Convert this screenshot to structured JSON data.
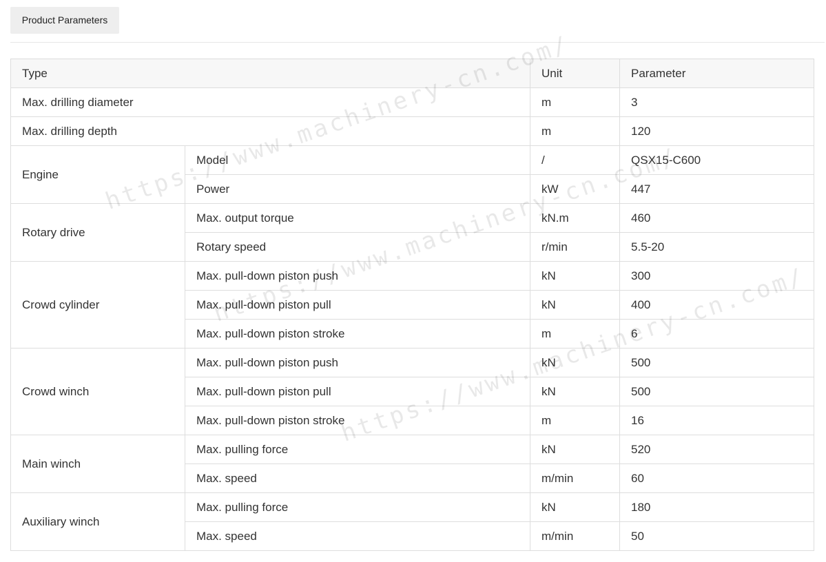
{
  "tab": {
    "label": "Product Parameters"
  },
  "table": {
    "headers": {
      "type": "Type",
      "unit": "Unit",
      "parameter": "Parameter"
    },
    "rows": [
      {
        "group": "Max. drilling diameter",
        "unit": "m",
        "value": "3"
      },
      {
        "group": "Max. drilling depth",
        "unit": "m",
        "value": "120"
      },
      {
        "group": "Engine",
        "items": [
          {
            "name": "Model",
            "unit": "/",
            "value": "QSX15-C600"
          },
          {
            "name": "Power",
            "unit": "kW",
            "value": "447"
          }
        ]
      },
      {
        "group": "Rotary drive",
        "items": [
          {
            "name": "Max. output torque",
            "unit": "kN.m",
            "value": "460"
          },
          {
            "name": "Rotary speed",
            "unit": "r/min",
            "value": "5.5-20"
          }
        ]
      },
      {
        "group": "Crowd cylinder",
        "items": [
          {
            "name": "Max. pull-down piston push",
            "unit": "kN",
            "value": "300"
          },
          {
            "name": "Max. pull-down piston pull",
            "unit": "kN",
            "value": "400"
          },
          {
            "name": "Max. pull-down piston stroke",
            "unit": "m",
            "value": "6"
          }
        ]
      },
      {
        "group": "Crowd winch",
        "items": [
          {
            "name": "Max. pull-down piston push",
            "unit": "kN",
            "value": "500"
          },
          {
            "name": "Max. pull-down piston pull",
            "unit": "kN",
            "value": "500"
          },
          {
            "name": "Max. pull-down piston stroke",
            "unit": "m",
            "value": "16"
          }
        ]
      },
      {
        "group": "Main winch",
        "items": [
          {
            "name": "Max. pulling force",
            "unit": "kN",
            "value": "520"
          },
          {
            "name": "Max. speed",
            "unit": "m/min",
            "value": "60"
          }
        ]
      },
      {
        "group": "Auxiliary winch",
        "items": [
          {
            "name": "Max. pulling force",
            "unit": "kN",
            "value": "180"
          },
          {
            "name": "Max. speed",
            "unit": "m/min",
            "value": "50"
          }
        ]
      }
    ]
  },
  "watermark": {
    "text": "https://www.machinery-cn.com/"
  }
}
